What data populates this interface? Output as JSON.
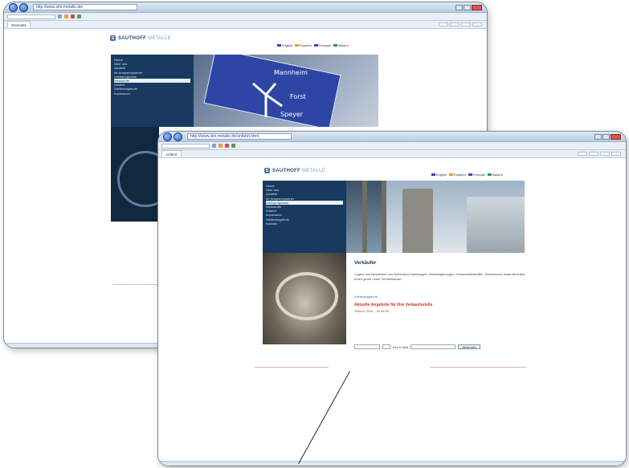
{
  "back_window": {
    "address": "http://www.slm-metalle.de/",
    "tab_label": "Startseite",
    "brand": {
      "mark": "S",
      "name_dark": "SAUTHOFF",
      "name_light": "METALLE"
    },
    "menu_items": [
      "Home",
      "Über uns",
      "Qualität",
      "Ihr Ansprechpartner",
      "Lieferprogramm",
      "Werkstoffe",
      "Anfahrt",
      "Stellenangebote",
      "Impressum"
    ],
    "active_menu_index": 5,
    "languages": [
      "English",
      "Español",
      "Français",
      "Italiano"
    ],
    "sign_labels": [
      "Mannheim",
      "Forst",
      "Speyer"
    ]
  },
  "front_window": {
    "address": "http://www.slm-metalle.de/anfahrt.html",
    "tab_label": "Anfahrt",
    "brand": {
      "mark": "S",
      "name_dark": "SAUTHOFF",
      "name_light": "METALLE"
    },
    "menu_items": [
      "Home",
      "Über uns",
      "Qualität",
      "Ihr Ansprechpartner",
      "Lieferprogramm",
      "Werkstoffe",
      "Anfahrt",
      "Impressum",
      "Stellenangebote",
      "Kontakt"
    ],
    "active_menu_index": 4,
    "languages": [
      "English",
      "Español",
      "Français",
      "Italiano"
    ],
    "article": {
      "title": "Verkäufer",
      "body": "Lagern und Bearbeiten von Nichteisen-Halbzeugen, Nickellegierungen, Sonderwerkstoffen. Telefonische Auskunft erteilt Ihnen gerne unser Vertriebsteam.",
      "link": "Stellenangebote",
      "red_heading": "Aktuelle Angebote für Ihre Verkaufsstelle",
      "red_sub": "Telefon: 0621 - 33 58 50"
    },
    "form": {
      "field_label": "Ihre E-Mail",
      "button_label": "Absenden"
    }
  },
  "colors": {
    "menu_bg": "#173a5e",
    "accent_red": "#c0392b",
    "brand_blue": "#4a6fa0"
  }
}
